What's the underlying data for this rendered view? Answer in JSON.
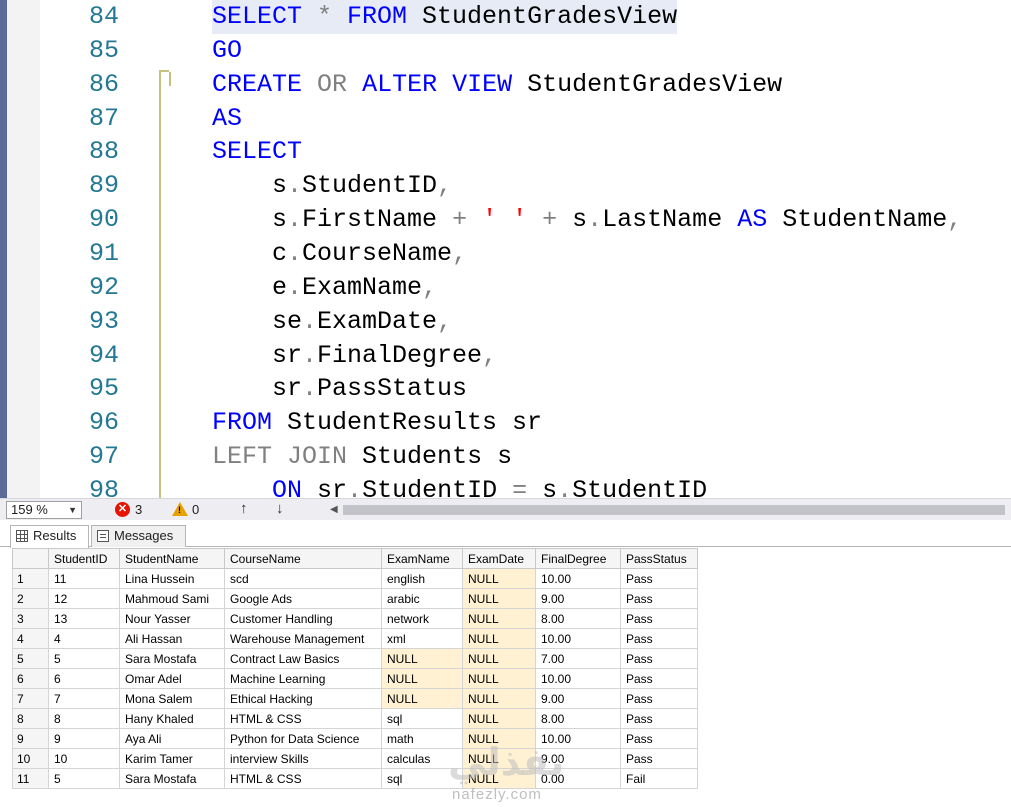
{
  "editor": {
    "lines": [
      {
        "num": "84",
        "tokens": [
          {
            "t": "SELECT",
            "c": "kw"
          },
          {
            "t": " * ",
            "c": "gray"
          },
          {
            "t": "FROM",
            "c": "kw"
          },
          {
            "t": " StudentGradesView",
            "c": ""
          }
        ]
      },
      {
        "num": "85",
        "tokens": [
          {
            "t": "GO",
            "c": "kw"
          }
        ]
      },
      {
        "num": "86",
        "tokens": [
          {
            "t": "CREATE",
            "c": "kw"
          },
          {
            "t": " ",
            "c": ""
          },
          {
            "t": "OR",
            "c": "gray"
          },
          {
            "t": " ",
            "c": ""
          },
          {
            "t": "ALTER",
            "c": "kw"
          },
          {
            "t": " ",
            "c": ""
          },
          {
            "t": "VIEW",
            "c": "kw"
          },
          {
            "t": " StudentGradesView",
            "c": ""
          }
        ]
      },
      {
        "num": "87",
        "tokens": [
          {
            "t": "AS",
            "c": "kw"
          }
        ]
      },
      {
        "num": "88",
        "tokens": [
          {
            "t": "SELECT",
            "c": "kw"
          }
        ]
      },
      {
        "num": "89",
        "tokens": [
          {
            "t": "    s",
            "c": ""
          },
          {
            "t": ".",
            "c": "gray"
          },
          {
            "t": "StudentID",
            "c": ""
          },
          {
            "t": ",",
            "c": "gray"
          }
        ]
      },
      {
        "num": "90",
        "tokens": [
          {
            "t": "    s",
            "c": ""
          },
          {
            "t": ".",
            "c": "gray"
          },
          {
            "t": "FirstName ",
            "c": ""
          },
          {
            "t": "+",
            "c": "gray"
          },
          {
            "t": " ",
            "c": ""
          },
          {
            "t": "' '",
            "c": "str"
          },
          {
            "t": " ",
            "c": ""
          },
          {
            "t": "+",
            "c": "gray"
          },
          {
            "t": " s",
            "c": ""
          },
          {
            "t": ".",
            "c": "gray"
          },
          {
            "t": "LastName ",
            "c": ""
          },
          {
            "t": "AS",
            "c": "kw"
          },
          {
            "t": " StudentName",
            "c": ""
          },
          {
            "t": ",",
            "c": "gray"
          }
        ]
      },
      {
        "num": "91",
        "tokens": [
          {
            "t": "    c",
            "c": ""
          },
          {
            "t": ".",
            "c": "gray"
          },
          {
            "t": "CourseName",
            "c": ""
          },
          {
            "t": ",",
            "c": "gray"
          }
        ]
      },
      {
        "num": "92",
        "tokens": [
          {
            "t": "    e",
            "c": ""
          },
          {
            "t": ".",
            "c": "gray"
          },
          {
            "t": "ExamName",
            "c": ""
          },
          {
            "t": ",",
            "c": "gray"
          }
        ]
      },
      {
        "num": "93",
        "tokens": [
          {
            "t": "    se",
            "c": ""
          },
          {
            "t": ".",
            "c": "gray"
          },
          {
            "t": "ExamDate",
            "c": ""
          },
          {
            "t": ",",
            "c": "gray"
          }
        ]
      },
      {
        "num": "94",
        "tokens": [
          {
            "t": "    sr",
            "c": ""
          },
          {
            "t": ".",
            "c": "gray"
          },
          {
            "t": "FinalDegree",
            "c": ""
          },
          {
            "t": ",",
            "c": "gray"
          }
        ]
      },
      {
        "num": "95",
        "tokens": [
          {
            "t": "    sr",
            "c": ""
          },
          {
            "t": ".",
            "c": "gray"
          },
          {
            "t": "PassStatus",
            "c": ""
          }
        ]
      },
      {
        "num": "96",
        "tokens": [
          {
            "t": "FROM",
            "c": "kw"
          },
          {
            "t": " StudentResults sr",
            "c": ""
          }
        ]
      },
      {
        "num": "97",
        "tokens": [
          {
            "t": "LEFT",
            "c": "gray"
          },
          {
            "t": " ",
            "c": ""
          },
          {
            "t": "JOIN",
            "c": "gray"
          },
          {
            "t": " Students s",
            "c": ""
          }
        ]
      },
      {
        "num": "98",
        "tokens": [
          {
            "t": "    ",
            "c": ""
          },
          {
            "t": "ON",
            "c": "kw"
          },
          {
            "t": " sr",
            "c": ""
          },
          {
            "t": ".",
            "c": "gray"
          },
          {
            "t": "StudentID ",
            "c": ""
          },
          {
            "t": "=",
            "c": "gray"
          },
          {
            "t": " s",
            "c": ""
          },
          {
            "t": ".",
            "c": "gray"
          },
          {
            "t": "StudentID",
            "c": ""
          }
        ]
      }
    ]
  },
  "status": {
    "zoom": "159 %",
    "errors": "3",
    "warnings": "0"
  },
  "tabs": {
    "results": "Results",
    "messages": "Messages"
  },
  "grid": {
    "columns": [
      "StudentID",
      "StudentName",
      "CourseName",
      "ExamName",
      "ExamDate",
      "FinalDegree",
      "PassStatus"
    ],
    "rows": [
      [
        "1",
        "11",
        "Lina Hussein",
        "scd",
        "english",
        "NULL",
        "10.00",
        "Pass"
      ],
      [
        "2",
        "12",
        "Mahmoud Sami",
        "Google Ads",
        "arabic",
        "NULL",
        "9.00",
        "Pass"
      ],
      [
        "3",
        "13",
        "Nour Yasser",
        "Customer Handling",
        "network",
        "NULL",
        "8.00",
        "Pass"
      ],
      [
        "4",
        "4",
        "Ali Hassan",
        "Warehouse Management",
        "xml",
        "NULL",
        "10.00",
        "Pass"
      ],
      [
        "5",
        "5",
        "Sara Mostafa",
        "Contract Law Basics",
        "NULL",
        "NULL",
        "7.00",
        "Pass"
      ],
      [
        "6",
        "6",
        "Omar Adel",
        "Machine Learning",
        "NULL",
        "NULL",
        "10.00",
        "Pass"
      ],
      [
        "7",
        "7",
        "Mona Salem",
        "Ethical Hacking",
        "NULL",
        "NULL",
        "9.00",
        "Pass"
      ],
      [
        "8",
        "8",
        "Hany Khaled",
        "HTML & CSS",
        "sql",
        "NULL",
        "8.00",
        "Pass"
      ],
      [
        "9",
        "9",
        "Aya Ali",
        "Python for Data Science",
        "math",
        "NULL",
        "10.00",
        "Pass"
      ],
      [
        "10",
        "10",
        "Karim Tamer",
        "interview Skills",
        "calculas",
        "NULL",
        "9.00",
        "Pass"
      ],
      [
        "11",
        "5",
        "Sara Mostafa",
        "HTML & CSS",
        "sql",
        "NULL",
        "0.00",
        "Fail"
      ]
    ]
  },
  "watermark": {
    "site": "nafezly.com"
  },
  "colors": {
    "keyword": "#0000ff",
    "operator": "#808080",
    "string": "#ff0000",
    "line_number": "#237893",
    "null_cell": "#fff1d2"
  }
}
